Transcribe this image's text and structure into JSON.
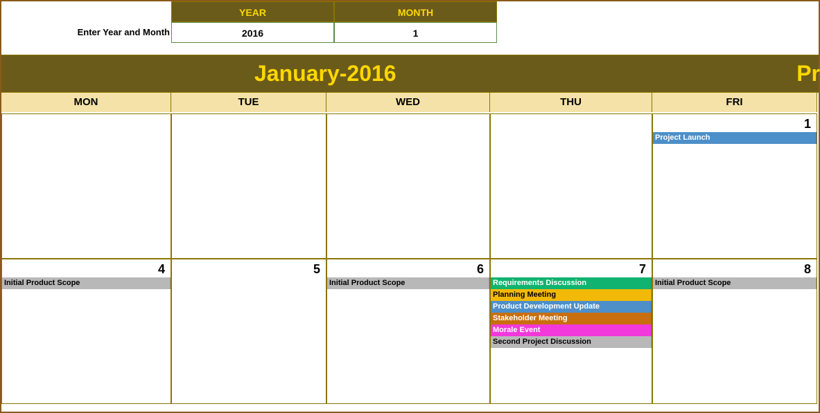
{
  "input": {
    "label": "Enter Year and Month",
    "year_header": "YEAR",
    "month_header": "MONTH",
    "year_value": "2016",
    "month_value": "1"
  },
  "title": {
    "main": "January-2016",
    "right": "Pr"
  },
  "days": {
    "mon": "MON",
    "tue": "TUE",
    "wed": "WED",
    "thu": "THU",
    "fri": "FRI"
  },
  "week1": {
    "fri": {
      "num": "1",
      "events": [
        {
          "label": "Project Launch",
          "cls": "event-blue"
        }
      ]
    }
  },
  "week2": {
    "mon": {
      "num": "4",
      "events": [
        {
          "label": "Initial Product Scope",
          "cls": "event-gray"
        }
      ]
    },
    "tue": {
      "num": "5"
    },
    "wed": {
      "num": "6",
      "events": [
        {
          "label": "Initial Product Scope",
          "cls": "event-gray"
        }
      ]
    },
    "thu": {
      "num": "7",
      "events": [
        {
          "label": "Requirements Discussion",
          "cls": "event-green"
        },
        {
          "label": "Planning Meeting",
          "cls": "event-yellow"
        },
        {
          "label": "Product Development Update",
          "cls": "event-blue"
        },
        {
          "label": "Stakeholder Meeting",
          "cls": "event-orange"
        },
        {
          "label": "Morale Event",
          "cls": "event-pink"
        },
        {
          "label": "Second Project Discussion",
          "cls": "event-gray"
        }
      ]
    },
    "fri": {
      "num": "8",
      "events": [
        {
          "label": "Initial Product Scope",
          "cls": "event-gray"
        }
      ]
    }
  }
}
